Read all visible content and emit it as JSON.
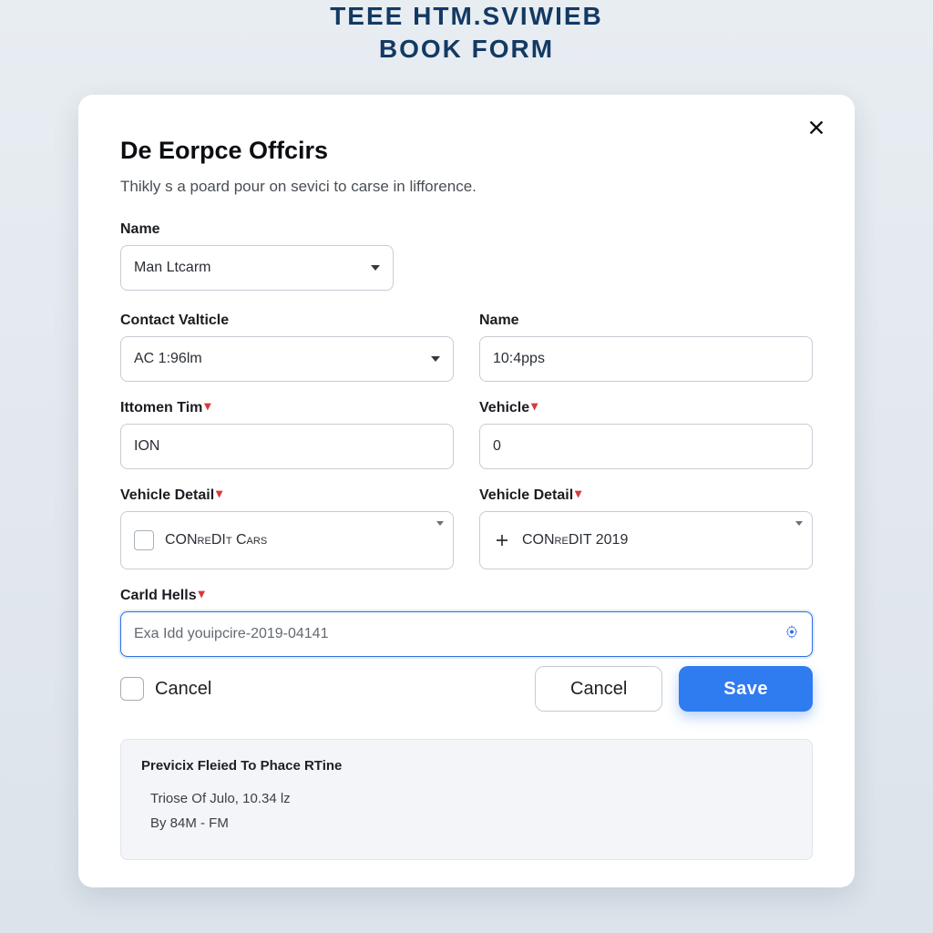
{
  "header": {
    "line1": "TEEE HTM.SVIWIEB",
    "line2": "BOOK FORM"
  },
  "modal": {
    "title": "De Eorpce Offcirs",
    "subtitle": "Thikly s a poard pour on sevici to carse in lifforence.",
    "fields": {
      "name_top": {
        "label": "Name",
        "value": "Man Ltcarm"
      },
      "contact_valticle": {
        "label": "Contact Valticle",
        "value": "AC 1:96lm"
      },
      "name_right": {
        "label": "Name",
        "value": "10:4pps"
      },
      "ittomen_tim": {
        "label": "Ittomen Tim",
        "value": "ION",
        "required": true
      },
      "vehicle": {
        "label": "Vehicle",
        "value": "0",
        "required": true
      },
      "vehicle_detail_left": {
        "label": "Vehicle Detail",
        "option": "CONreDIt Cars",
        "required": true
      },
      "vehicle_detail_right": {
        "label": "Vehicle Detail",
        "option": "CONreDIT 2019",
        "required": true
      },
      "carld_hells": {
        "label": "Carld Hells",
        "placeholder": "Exa Idd youipcire-2019-04141",
        "required": true
      }
    },
    "actions": {
      "cancel_checkbox_label": "Cancel",
      "cancel_button": "Cancel",
      "save_button": "Save"
    },
    "preview": {
      "title": "Previcix Fleied To Phace RTine",
      "line1": "Triose Of Julo, 10.34 lz",
      "line2": "By 84M - FM"
    }
  }
}
